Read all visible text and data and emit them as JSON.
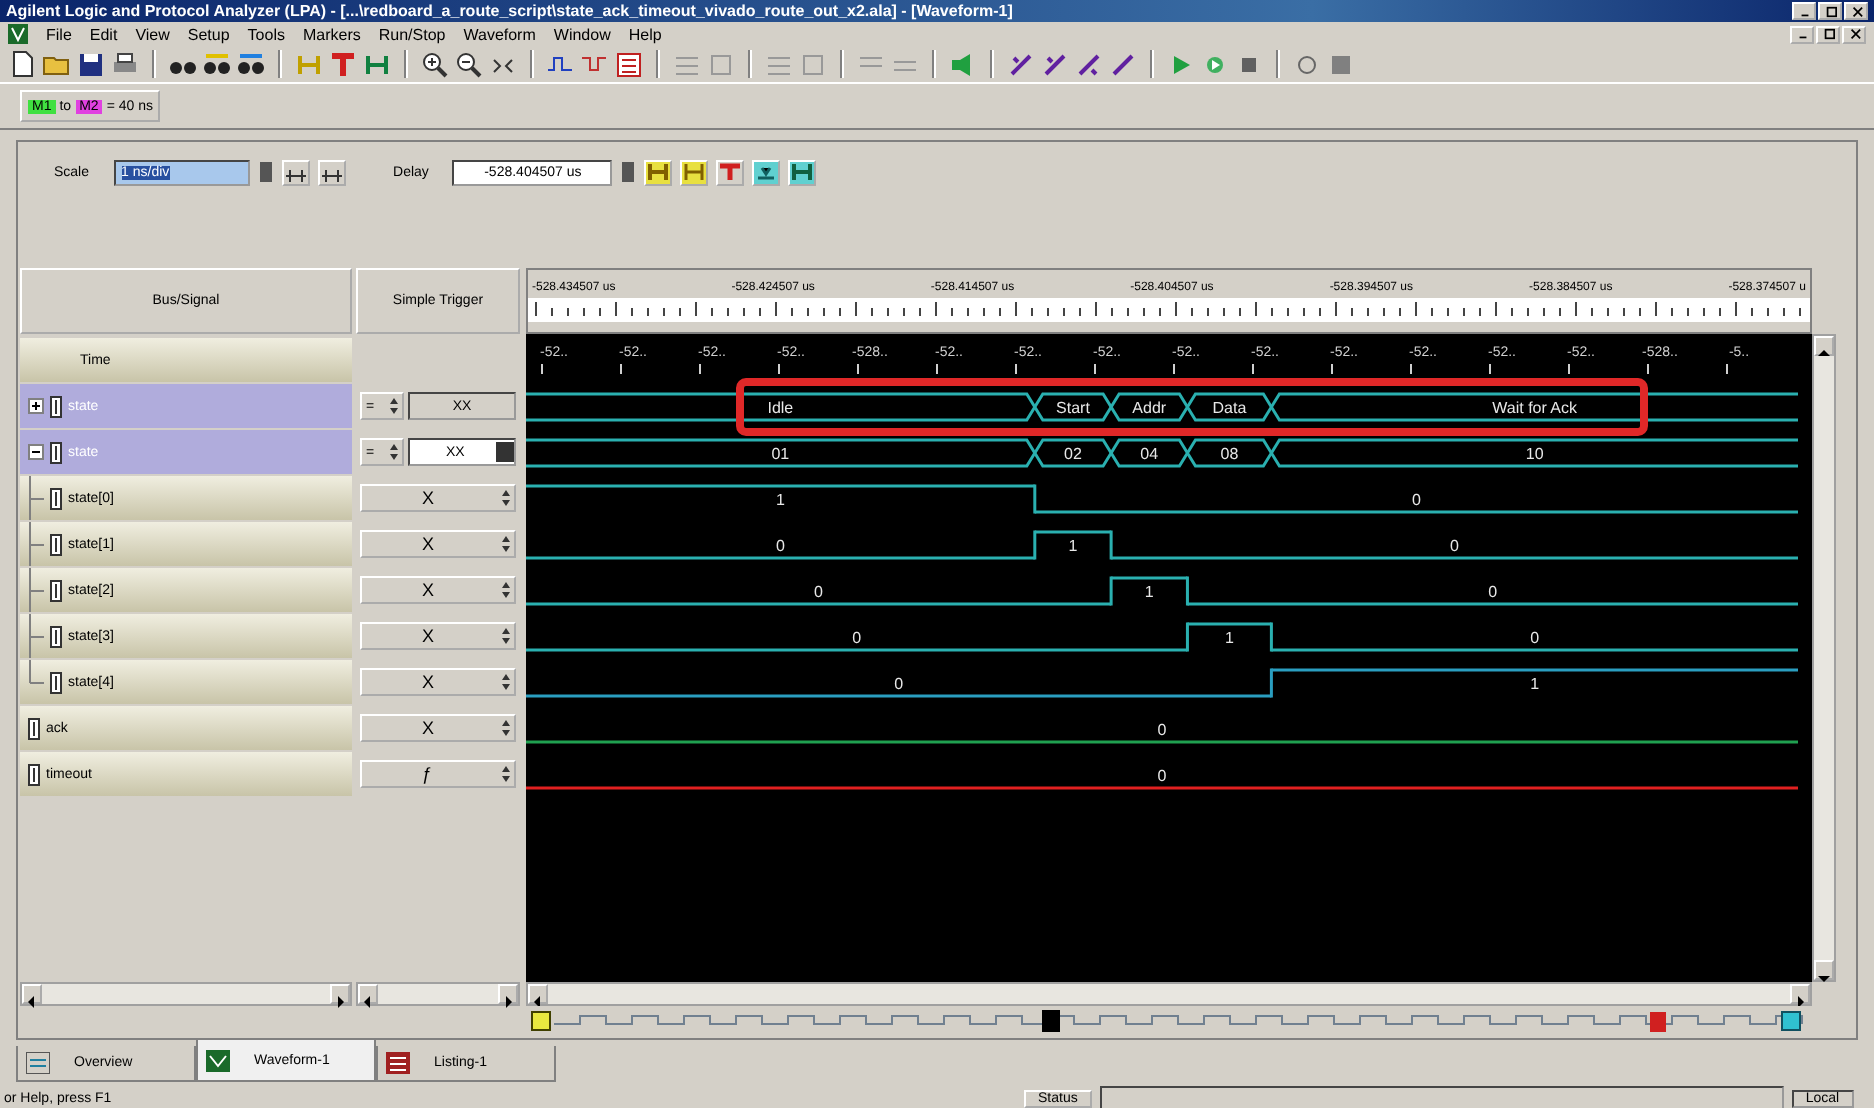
{
  "window": {
    "title": "Agilent Logic and Protocol Analyzer (LPA) - [...\\redboard_a_route_script\\state_ack_timeout_vivado_route_out_x2.ala] - [Waveform-1]"
  },
  "menu": [
    "File",
    "Edit",
    "View",
    "Setup",
    "Tools",
    "Markers",
    "Run/Stop",
    "Waveform",
    "Window",
    "Help"
  ],
  "marker_measure": {
    "from": "M1",
    "joiner": "to",
    "to": "M2",
    "reading": "= 40 ns"
  },
  "scale": {
    "label": "Scale",
    "value": "1 ns/div"
  },
  "delay": {
    "label": "Delay",
    "value": "-528.404507 us"
  },
  "columns": {
    "signal": "Bus/Signal",
    "trigger": "Simple Trigger"
  },
  "time_labels": [
    "-528.434507 us",
    "-528.424507 us",
    "-528.414507 us",
    "-528.404507 us",
    "-528.394507 us",
    "-528.384507 us",
    "-528.374507 u"
  ],
  "ruler_labels": [
    "-52..",
    "-52..",
    "-52..",
    "-52..",
    "-528..",
    "-52..",
    "-52..",
    "-52..",
    "-52..",
    "-52..",
    "-52..",
    "-52..",
    "-52..",
    "-52..",
    "-528..",
    "-5.."
  ],
  "signals": [
    {
      "name": "Time",
      "kind": "time",
      "selected": false
    },
    {
      "name": "state",
      "kind": "bus",
      "selected": true,
      "expanded": false,
      "color": "#2ab0b0",
      "trigger": {
        "kind": "field",
        "op": "=",
        "value": "XX"
      },
      "segments": [
        {
          "value": "Idle"
        },
        {
          "value": "Start"
        },
        {
          "value": "Addr"
        },
        {
          "value": "Data"
        },
        {
          "value": "Wait for Ack"
        }
      ]
    },
    {
      "name": "state",
      "kind": "bus",
      "selected": true,
      "expanded": true,
      "color": "#2ab0b0",
      "trigger": {
        "kind": "combo",
        "op": "=",
        "value": "XX"
      },
      "segments": [
        {
          "value": "01"
        },
        {
          "value": "02"
        },
        {
          "value": "04"
        },
        {
          "value": "08"
        },
        {
          "value": "10"
        }
      ],
      "children": [
        {
          "name": "state[0]",
          "kind": "bit",
          "selected": false,
          "color": "#2ab0b0",
          "trigger": {
            "kind": "spin",
            "value": "X"
          },
          "segments": [
            {
              "value": "1",
              "high": true
            },
            {
              "value": "0",
              "high": false
            }
          ]
        },
        {
          "name": "state[1]",
          "kind": "bit",
          "selected": false,
          "color": "#2ab0b0",
          "trigger": {
            "kind": "spin",
            "value": "X"
          },
          "segments": [
            {
              "value": "0",
              "high": false
            },
            {
              "value": "1",
              "high": true
            },
            {
              "value": "0",
              "high": false
            }
          ]
        },
        {
          "name": "state[2]",
          "kind": "bit",
          "selected": false,
          "color": "#2ab0b0",
          "trigger": {
            "kind": "spin",
            "value": "X"
          },
          "segments": [
            {
              "value": "0",
              "high": false
            },
            {
              "value": "1",
              "high": true
            },
            {
              "value": "0",
              "high": false
            }
          ]
        },
        {
          "name": "state[3]",
          "kind": "bit",
          "selected": false,
          "color": "#2ab0b0",
          "trigger": {
            "kind": "spin",
            "value": "X"
          },
          "segments": [
            {
              "value": "0",
              "high": false
            },
            {
              "value": "1",
              "high": true
            },
            {
              "value": "0",
              "high": false
            }
          ]
        },
        {
          "name": "state[4]",
          "kind": "bit",
          "selected": false,
          "color": "#2a9ec0",
          "trigger": {
            "kind": "spin",
            "value": "X"
          },
          "segments": [
            {
              "value": "0",
              "high": false
            },
            {
              "value": "1",
              "high": true
            }
          ]
        }
      ]
    },
    {
      "name": "ack",
      "kind": "bit",
      "selected": false,
      "color": "#20a050",
      "trigger": {
        "kind": "spin",
        "value": "X"
      },
      "segments": [
        {
          "value": "0"
        }
      ]
    },
    {
      "name": "timeout",
      "kind": "bit",
      "selected": false,
      "color": "#e02020",
      "trigger": {
        "kind": "spin",
        "value": "ƒ"
      },
      "segments": [
        {
          "value": "0"
        }
      ]
    }
  ],
  "tabs": [
    {
      "label": "Overview",
      "selected": false
    },
    {
      "label": "Waveform-1",
      "selected": true
    },
    {
      "label": "Listing-1",
      "selected": false
    }
  ],
  "status_bar": {
    "help": "or Help, press F1",
    "status_label": "Status",
    "mode": "Local"
  }
}
